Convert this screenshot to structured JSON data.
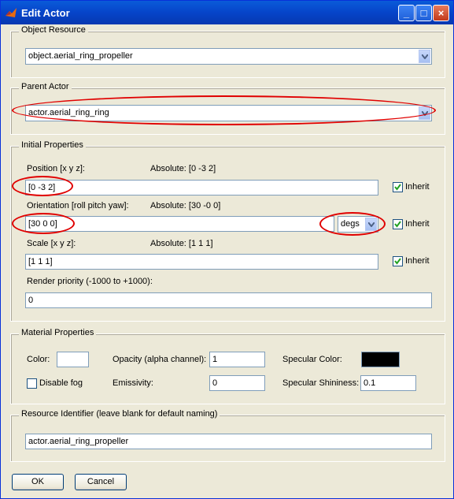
{
  "window": {
    "title": "Edit Actor"
  },
  "object_resource": {
    "label": "Object Resource",
    "value": "object.aerial_ring_propeller"
  },
  "parent_actor": {
    "label": "Parent Actor",
    "value": "actor.aerial_ring_ring"
  },
  "initial": {
    "label": "Initial Properties",
    "position": {
      "label": "Position [x y z]:",
      "absolute": "Absolute: [0 -3 2]",
      "value": "[0 -3 2]",
      "inherit_label": "Inherit",
      "inherit": true
    },
    "orientation": {
      "label": "Orientation [roll pitch yaw]:",
      "absolute": "Absolute: [30 -0 0]",
      "value": "[30 0 0]",
      "units": "degs",
      "inherit_label": "Inherit",
      "inherit": true
    },
    "scale": {
      "label": "Scale [x y z]:",
      "absolute": "Absolute: [1 1 1]",
      "value": "[1 1 1]",
      "inherit_label": "Inherit",
      "inherit": true
    },
    "render_priority": {
      "label": "Render priority (-1000 to +1000):",
      "value": "0"
    }
  },
  "material": {
    "label": "Material Properties",
    "color_label": "Color:",
    "color": "#ffffff",
    "opacity_label": "Opacity (alpha channel):",
    "opacity": "1",
    "specular_color_label": "Specular Color:",
    "specular_color": "#000000",
    "disable_fog_label": "Disable fog",
    "disable_fog": false,
    "emissivity_label": "Emissivity:",
    "emissivity": "0",
    "shininess_label": "Specular Shininess:",
    "shininess": "0.1"
  },
  "resource_id": {
    "label": "Resource Identifier (leave blank for default naming)",
    "value": "actor.aerial_ring_propeller"
  },
  "buttons": {
    "ok": "OK",
    "cancel": "Cancel"
  },
  "annotation_color": "#e00000"
}
